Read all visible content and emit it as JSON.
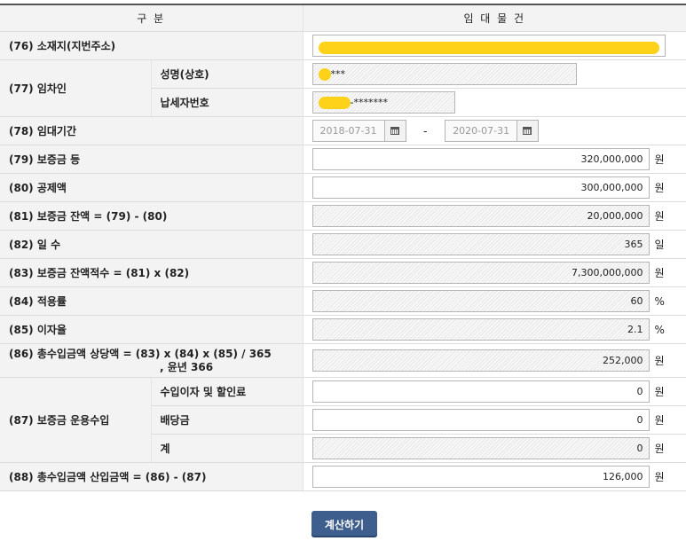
{
  "header": {
    "col1": "구 분",
    "col2": "임 대 물 건"
  },
  "rows": {
    "r76": {
      "label": "(76) 소재지(지번주소)"
    },
    "r77": {
      "label": "(77) 임차인",
      "sub1": "성명(상호)",
      "name_value": "***",
      "sub2": "납세자번호",
      "taxno_value": "-*******"
    },
    "r78": {
      "label": "(78) 임대기간",
      "start": "2018-07-31",
      "sep": "-",
      "end": "2020-07-31"
    },
    "r79": {
      "label": "(79) 보증금 등",
      "value": "320,000,000",
      "unit": "원"
    },
    "r80": {
      "label": "(80) 공제액",
      "value": "300,000,000",
      "unit": "원"
    },
    "r81": {
      "label": "(81) 보증금 잔액 = (79) - (80)",
      "value": "20,000,000",
      "unit": "원"
    },
    "r82": {
      "label": "(82) 일 수",
      "value": "365",
      "unit": "일"
    },
    "r83": {
      "label": "(83) 보증금 잔액적수 = (81) x (82)",
      "value": "7,300,000,000",
      "unit": "원"
    },
    "r84": {
      "label": "(84) 적용률",
      "value": "60",
      "unit": "%"
    },
    "r85": {
      "label": "(85) 이자율",
      "value": "2.1",
      "unit": "%"
    },
    "r86": {
      "label_line1": "(86) 총수입금액 상당액 = (83) x (84) x (85) / 365",
      "label_line2": ", 윤년 366",
      "value": "252,000",
      "unit": "원"
    },
    "r87": {
      "label": "(87) 보증금 운용수입",
      "sub1": "수입이자 및 할인료",
      "v1": "0",
      "sub2": "배당금",
      "v2": "0",
      "sub3": "계",
      "v3": "0",
      "unit": "원"
    },
    "r88": {
      "label": "(88) 총수입금액 산입금액 = (86) - (87)",
      "value": "126,000",
      "unit": "원"
    }
  },
  "actions": {
    "calculate": "계산하기"
  },
  "colors": {
    "header_bg": "#f3f3f3",
    "button_bg": "#3e5f8e",
    "redaction": "#ffd21a"
  }
}
